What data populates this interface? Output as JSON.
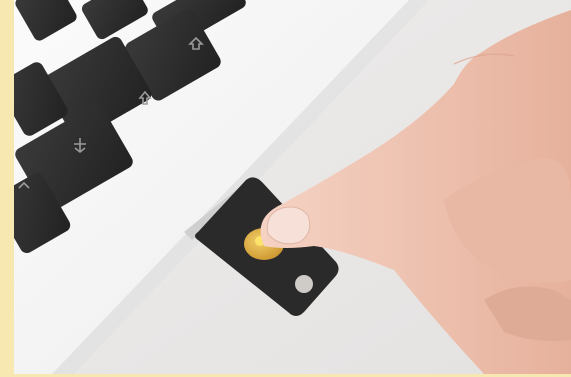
{
  "image": {
    "alt": "",
    "colors": {
      "page_background": "#f7e7b0",
      "desk": "#e9e7e6",
      "laptop_body": "#f6f6f6",
      "keys": "#2c2c2c",
      "security_key": "#2a2a2a",
      "gold_contact": "#d7a748",
      "indicator_light": "#ffe56a",
      "skin": "#f2c8b6"
    },
    "icons": [
      "key-symbol-icon",
      "eject-key-icon",
      "key-legend-icon"
    ]
  }
}
